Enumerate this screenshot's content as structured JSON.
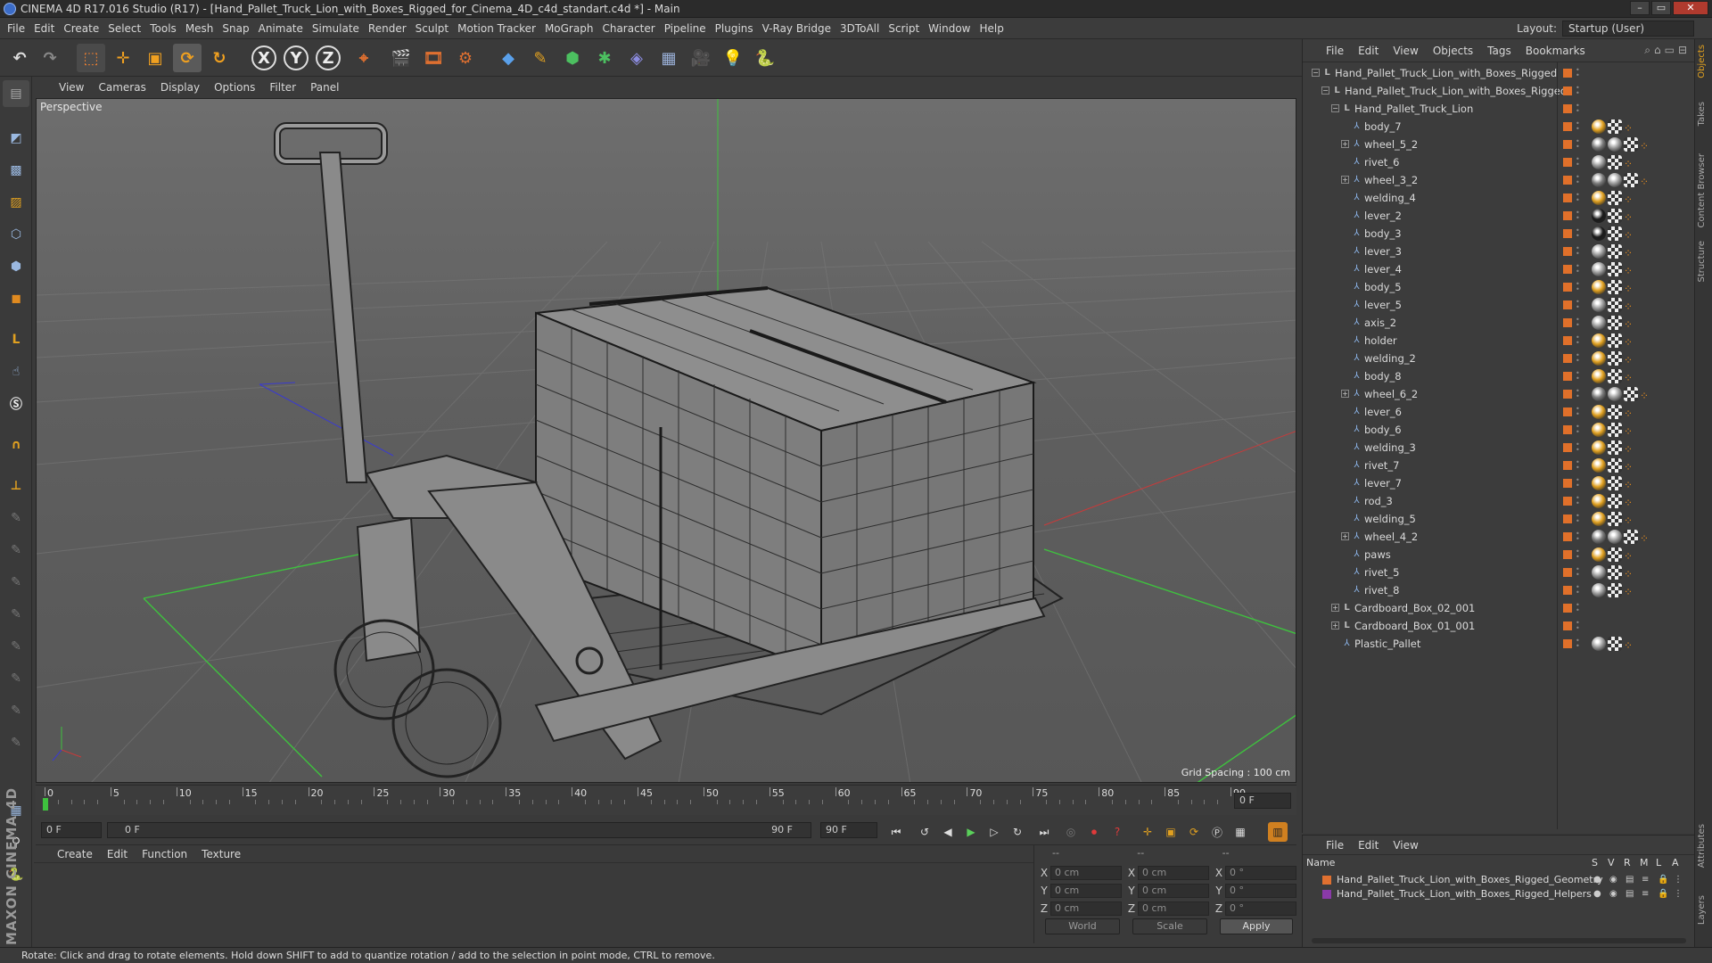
{
  "window": {
    "title": "CINEMA 4D R17.016 Studio (R17) - [Hand_Pallet_Truck_Lion_with_Boxes_Rigged_for_Cinema_4D_c4d_standart.c4d *] - Main",
    "close": "✕",
    "min": "–",
    "max": "▭"
  },
  "menubar": [
    "File",
    "Edit",
    "Create",
    "Select",
    "Tools",
    "Mesh",
    "Snap",
    "Animate",
    "Simulate",
    "Render",
    "Sculpt",
    "Motion Tracker",
    "MoGraph",
    "Character",
    "Pipeline",
    "Plugins",
    "V-Ray Bridge",
    "3DToAll",
    "Script",
    "Window",
    "Help"
  ],
  "layout": {
    "label": "Layout:",
    "value": "Startup (User)"
  },
  "toolbar": {
    "x": "X",
    "y": "Y",
    "z": "Z"
  },
  "viewport": {
    "menu": [
      "View",
      "Cameras",
      "Display",
      "Options",
      "Filter",
      "Panel"
    ],
    "label": "Perspective",
    "grid_spacing": "Grid Spacing : 100 cm"
  },
  "timeline": {
    "ticks": [
      "0",
      "5",
      "10",
      "15",
      "20",
      "25",
      "30",
      "35",
      "40",
      "45",
      "50",
      "55",
      "60",
      "65",
      "70",
      "75",
      "80",
      "85",
      "90"
    ],
    "current_frame": "0 F",
    "start_frame": "0 F",
    "range_start": "0 F",
    "range_end": "90 F",
    "end_frame": "90 F"
  },
  "material_panel": {
    "menu": [
      "Create",
      "Edit",
      "Function",
      "Texture"
    ]
  },
  "coordinates": {
    "header": [
      "--",
      "--",
      "--"
    ],
    "rows": [
      {
        "a": "X",
        "av": "0 cm",
        "b": "X",
        "bv": "0 cm",
        "c": "X",
        "cv": "0 °"
      },
      {
        "a": "Y",
        "av": "0 cm",
        "b": "Y",
        "bv": "0 cm",
        "c": "Y",
        "cv": "0 °"
      },
      {
        "a": "Z",
        "av": "0 cm",
        "b": "Z",
        "bv": "0 cm",
        "c": "Z",
        "cv": "0 °"
      }
    ],
    "world": "World",
    "scale": "Scale",
    "apply": "Apply"
  },
  "status": "Rotate: Click and drag to rotate elements. Hold down SHIFT to add to quantize rotation / add to the selection in point mode, CTRL to remove.",
  "object_manager": {
    "menu": [
      "File",
      "Edit",
      "View",
      "Objects",
      "Tags",
      "Bookmarks"
    ],
    "objects": [
      {
        "name": "Hand_Pallet_Truck_Lion_with_Boxes_Rigged",
        "level": 0,
        "type": "null",
        "exp": "−",
        "tags": []
      },
      {
        "name": "Hand_Pallet_Truck_Lion_with_Boxes_Rigged",
        "level": 1,
        "type": "null",
        "exp": "−",
        "tags": []
      },
      {
        "name": "Hand_Pallet_Truck_Lion",
        "level": 2,
        "type": "null",
        "exp": "−",
        "tags": []
      },
      {
        "name": "body_7",
        "level": 3,
        "type": "bone",
        "exp": "",
        "tags": [
          "#e0a020",
          "#2b2b2b",
          "#e08a20"
        ]
      },
      {
        "name": "wheel_5_2",
        "level": 3,
        "type": "bone",
        "exp": "+",
        "tags": [
          "#7a7a7a",
          "#9a9a9a",
          "#2b2b2b",
          "#e08a20"
        ]
      },
      {
        "name": "rivet_6",
        "level": 3,
        "type": "bone",
        "exp": "",
        "tags": [
          "#9a9a9a",
          "#2b2b2b",
          "#e08a20"
        ]
      },
      {
        "name": "wheel_3_2",
        "level": 3,
        "type": "bone",
        "exp": "+",
        "tags": [
          "#7a7a7a",
          "#9a9a9a",
          "#2b2b2b",
          "#e08a20"
        ]
      },
      {
        "name": "welding_4",
        "level": 3,
        "type": "bone",
        "exp": "",
        "tags": [
          "#e0a020",
          "#2b2b2b",
          "#e08a20"
        ]
      },
      {
        "name": "lever_2",
        "level": 3,
        "type": "bone",
        "exp": "",
        "tags": [
          "#1a1a1a",
          "#2b2b2b",
          "#e08a20"
        ]
      },
      {
        "name": "body_3",
        "level": 3,
        "type": "bone",
        "exp": "",
        "tags": [
          "#1a1a1a",
          "#2b2b2b",
          "#e08a20"
        ]
      },
      {
        "name": "lever_3",
        "level": 3,
        "type": "bone",
        "exp": "",
        "tags": [
          "#9a9a9a",
          "#2b2b2b",
          "#e08a20"
        ]
      },
      {
        "name": "lever_4",
        "level": 3,
        "type": "bone",
        "exp": "",
        "tags": [
          "#9a9a9a",
          "#2b2b2b",
          "#e08a20"
        ]
      },
      {
        "name": "body_5",
        "level": 3,
        "type": "bone",
        "exp": "",
        "tags": [
          "#e0a020",
          "#2b2b2b",
          "#e08a20"
        ]
      },
      {
        "name": "lever_5",
        "level": 3,
        "type": "bone",
        "exp": "",
        "tags": [
          "#9a9a9a",
          "#2b2b2b",
          "#e08a20"
        ]
      },
      {
        "name": "axis_2",
        "level": 3,
        "type": "bone",
        "exp": "",
        "tags": [
          "#9a9a9a",
          "#2b2b2b",
          "#e08a20"
        ]
      },
      {
        "name": "holder",
        "level": 3,
        "type": "bone",
        "exp": "",
        "tags": [
          "#e0a020",
          "#2b2b2b",
          "#e08a20"
        ]
      },
      {
        "name": "welding_2",
        "level": 3,
        "type": "bone",
        "exp": "",
        "tags": [
          "#e0a020",
          "#2b2b2b",
          "#e08a20"
        ]
      },
      {
        "name": "body_8",
        "level": 3,
        "type": "bone",
        "exp": "",
        "tags": [
          "#e0a020",
          "#2b2b2b",
          "#e08a20"
        ]
      },
      {
        "name": "wheel_6_2",
        "level": 3,
        "type": "bone",
        "exp": "+",
        "tags": [
          "#7a7a7a",
          "#9a9a9a",
          "#2b2b2b",
          "#e08a20"
        ]
      },
      {
        "name": "lever_6",
        "level": 3,
        "type": "bone",
        "exp": "",
        "tags": [
          "#e0a020",
          "#2b2b2b",
          "#e08a20"
        ]
      },
      {
        "name": "body_6",
        "level": 3,
        "type": "bone",
        "exp": "",
        "tags": [
          "#e0a020",
          "#2b2b2b",
          "#e08a20"
        ]
      },
      {
        "name": "welding_3",
        "level": 3,
        "type": "bone",
        "exp": "",
        "tags": [
          "#e0a020",
          "#2b2b2b",
          "#e08a20"
        ]
      },
      {
        "name": "rivet_7",
        "level": 3,
        "type": "bone",
        "exp": "",
        "tags": [
          "#e0a020",
          "#2b2b2b",
          "#e08a20"
        ]
      },
      {
        "name": "lever_7",
        "level": 3,
        "type": "bone",
        "exp": "",
        "tags": [
          "#e0a020",
          "#2b2b2b",
          "#e08a20"
        ]
      },
      {
        "name": "rod_3",
        "level": 3,
        "type": "bone",
        "exp": "",
        "tags": [
          "#e0a020",
          "#2b2b2b",
          "#e08a20"
        ]
      },
      {
        "name": "welding_5",
        "level": 3,
        "type": "bone",
        "exp": "",
        "tags": [
          "#e0a020",
          "#2b2b2b",
          "#e08a20"
        ]
      },
      {
        "name": "wheel_4_2",
        "level": 3,
        "type": "bone",
        "exp": "+",
        "tags": [
          "#7a7a7a",
          "#9a9a9a",
          "#2b2b2b",
          "#e08a20"
        ]
      },
      {
        "name": "paws",
        "level": 3,
        "type": "bone",
        "exp": "",
        "tags": [
          "#e0a020",
          "#2b2b2b",
          "#e08a20"
        ]
      },
      {
        "name": "rivet_5",
        "level": 3,
        "type": "bone",
        "exp": "",
        "tags": [
          "#9a9a9a",
          "#2b2b2b",
          "#e08a20"
        ]
      },
      {
        "name": "rivet_8",
        "level": 3,
        "type": "bone",
        "exp": "",
        "tags": [
          "#9a9a9a",
          "#2b2b2b",
          "#e08a20"
        ]
      },
      {
        "name": "Cardboard_Box_02_001",
        "level": 2,
        "type": "null",
        "exp": "+",
        "tags": []
      },
      {
        "name": "Cardboard_Box_01_001",
        "level": 2,
        "type": "null",
        "exp": "+",
        "tags": []
      },
      {
        "name": "Plastic_Pallet",
        "level": 2,
        "type": "bone",
        "exp": "",
        "tags": [
          "#9a9a9a",
          "#2b2b2b",
          "#e08a20"
        ]
      }
    ]
  },
  "right_tabs": [
    "Objects",
    "Takes",
    "Content Browser",
    "Structure",
    "Attributes",
    "Layers"
  ],
  "layer_manager": {
    "menu": [
      "File",
      "Edit",
      "View"
    ],
    "columns": {
      "name": "Name",
      "s": "S",
      "v": "V",
      "r": "R",
      "m": "M",
      "l": "L",
      "a": "A"
    },
    "layers": [
      {
        "name": "Hand_Pallet_Truck_Lion_with_Boxes_Rigged_Geometry",
        "color": "#e07030"
      },
      {
        "name": "Hand_Pallet_Truck_Lion_with_Boxes_Rigged_Helpers",
        "color": "#8a3aa8"
      }
    ]
  },
  "brand": "MAXON CINEMA 4D"
}
